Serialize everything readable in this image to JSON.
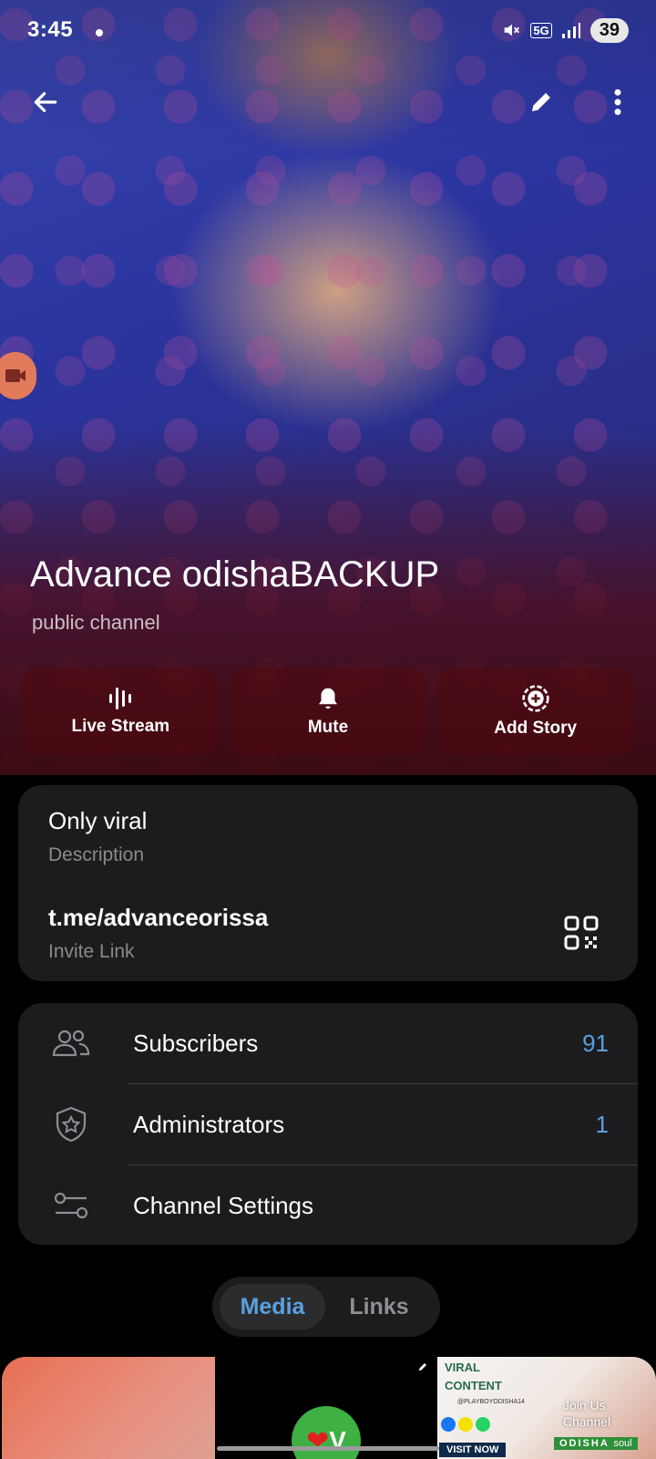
{
  "status_bar": {
    "time": "3:45",
    "network": "5G",
    "battery": "39"
  },
  "header": {
    "channel_name": "Advance odishaBACKUP",
    "channel_type": "public channel",
    "icons": [
      "back-arrow-icon",
      "pencil-icon",
      "more-vertical-icon",
      "video-camera-icon"
    ]
  },
  "actions": [
    {
      "label": "Live Stream",
      "icon": "live-stream-icon"
    },
    {
      "label": "Mute",
      "icon": "bell-icon"
    },
    {
      "label": "Add Story",
      "icon": "add-story-icon"
    }
  ],
  "info": {
    "description": "Only viral",
    "description_caption": "Description",
    "invite_link": "t.me/advanceorissa",
    "invite_link_caption": "Invite Link"
  },
  "menu": [
    {
      "label": "Subscribers",
      "count": "91",
      "icon": "users-icon"
    },
    {
      "label": "Administrators",
      "count": "1",
      "icon": "shield-star-icon"
    },
    {
      "label": "Channel Settings",
      "count": "",
      "icon": "sliders-icon"
    }
  ],
  "tabs": {
    "active": "Media",
    "inactive": "Links"
  },
  "media_tiles": {
    "tile2_letter": "V",
    "tile3_line1": "VIRAL",
    "tile3_line2": "CONTENT",
    "tile3_handle": "@PLAYBOYODISHA14",
    "tile3_join1": "Join Us",
    "tile3_join2": "Channel",
    "tile3_brand": "ODISHA",
    "tile3_brand_suffix": "soul",
    "tile3_visit": "VISIT NOW"
  },
  "colors": {
    "accent": "#5aa0e0",
    "card_bg": "#1c1c1e",
    "page_bg": "#000000"
  }
}
